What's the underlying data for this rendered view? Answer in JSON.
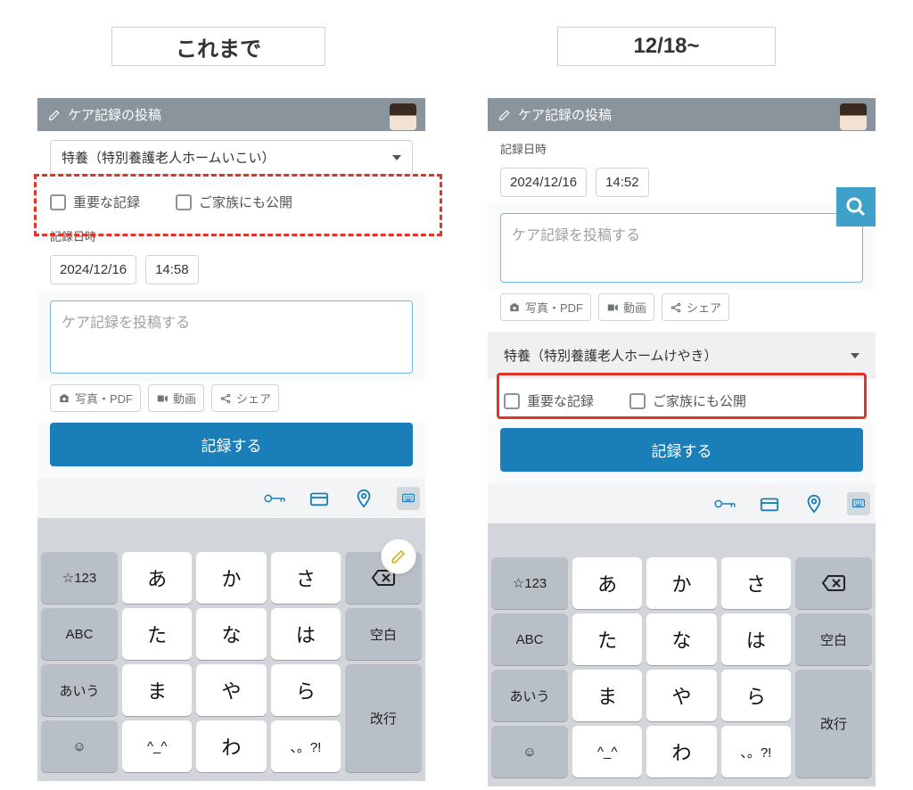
{
  "titles": {
    "left": "これまで",
    "right": "12/18~"
  },
  "left": {
    "header": "ケア記録の投稿",
    "facility_select": "特養（特別養護老人ホームいこい）",
    "check_importance": "重要な記録",
    "check_family": "ご家族にも公開",
    "date_label": "記録日時",
    "date": "2024/12/16",
    "time": "14:58",
    "textarea_placeholder": "ケア記録を投稿する",
    "attach_photo": "写真・PDF",
    "attach_video": "動画",
    "attach_share": "シェア",
    "submit": "記録する"
  },
  "right": {
    "header": "ケア記録の投稿",
    "date_label": "記録日時",
    "date": "2024/12/16",
    "time": "14:52",
    "textarea_placeholder": "ケア記録を投稿する",
    "attach_photo": "写真・PDF",
    "attach_video": "動画",
    "attach_share": "シェア",
    "facility_select": "特養（特別養護老人ホームけやき）",
    "check_importance": "重要な記録",
    "check_family": "ご家族にも公開",
    "submit": "記録する"
  },
  "keyboard": {
    "mode123": "☆123",
    "abc": "ABC",
    "kana": "あいう",
    "emoji": "☺",
    "space": "空白",
    "return": "改行",
    "rows": [
      [
        "あ",
        "か",
        "さ"
      ],
      [
        "た",
        "な",
        "は"
      ],
      [
        "ま",
        "や",
        "ら"
      ],
      [
        "^_^",
        "わ",
        "、。?!"
      ]
    ]
  }
}
